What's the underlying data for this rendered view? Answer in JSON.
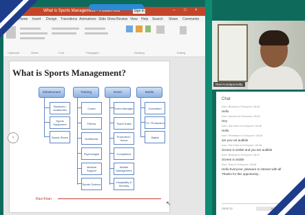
{
  "ppt": {
    "title": "What is Sports Management - PowerPoint",
    "share_label": "",
    "signin_label": "Sign in",
    "window_buttons": [
      "–",
      "□",
      "×"
    ],
    "tabs": [
      "File",
      "Home",
      "Insert",
      "Design",
      "Transitions",
      "Animations",
      "Slide Show",
      "Review",
      "View",
      "Help",
      "Search",
      "Share",
      "Comments"
    ],
    "ribbon_groups": [
      "Clipboard",
      "Slides",
      "Font",
      "Paragraph",
      "Drawing",
      "Editing"
    ]
  },
  "slide": {
    "title": "What is Sports Management?",
    "nav_arrow": "‹",
    "columns": [
      {
        "header": "Infrastructure",
        "items": [
          "Stadiums / Academies",
          "Sports Equipment",
          "Sports Shoes"
        ]
      },
      {
        "header": "Training",
        "items": [
          "Coach",
          "Fitness",
          "Nutritionist",
          "Psychologist",
          "Medical Support",
          "Sports Science"
        ]
      },
      {
        "header": "Event",
        "items": [
          "Event Manager",
          "Ticket Sales",
          "Promotion / Venue",
          "Compliance",
          "Athlete Management",
          "Hospitality & Security"
        ]
      },
      {
        "header": "Media",
        "items": [
          "Journalism",
          "TV / Production",
          "Digital"
        ]
      }
    ],
    "footer_text": "Ravi Kiran"
  },
  "video": {
    "name_label": "Ravi Kondapureddy"
  },
  "chat": {
    "title": "Chat",
    "messages": [
      {
        "meta": "from: Bhavya to Everyone: 08:45",
        "text": "Hello"
      },
      {
        "meta": "from: Naveen to Everyone: 08:45",
        "text": "Hey"
      },
      {
        "meta": "from: Sai Kiran to Everyone: 08:46",
        "text": "Hello"
      },
      {
        "meta": "from: Preetham to Everyone: 08:46",
        "text": "are you not audible"
      },
      {
        "meta": "from: Sai Kiran to Everyone: 08:46",
        "text": "Screen is visible and you are audible"
      },
      {
        "meta": "from: Bhavya to Everyone: 08:47",
        "text": "Screen is visible"
      },
      {
        "meta": "from: Ravi to Everyone: 08:48",
        "text": "Hello Everyone, pleasure to interact with all"
      },
      {
        "meta": "",
        "text": "Thanks for this opportunity..."
      }
    ],
    "input_label": "Send to:",
    "send_target": "Everyone"
  }
}
